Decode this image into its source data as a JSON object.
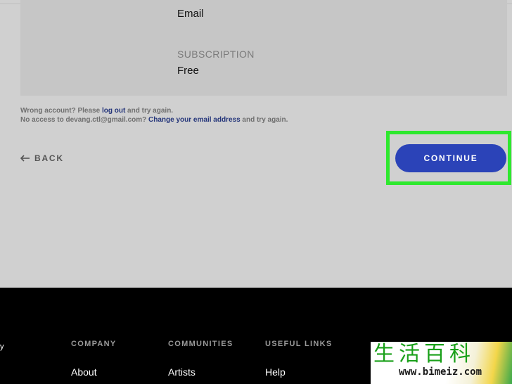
{
  "account_card": {
    "email_value": "Email",
    "plan_label": "SUBSCRIPTION",
    "plan_value": "Free"
  },
  "help": {
    "line1_prefix": "Wrong account? Please ",
    "line1_link": "log out",
    "line1_suffix": " and try again.",
    "line2_prefix": "No access to devang.ctl@gmail.com? ",
    "line2_link": "Change your email address",
    "line2_suffix": " and try again."
  },
  "actions": {
    "back_label": "BACK",
    "back_icon": "arrow-left-icon",
    "continue_label": "CONTINUE"
  },
  "footer": {
    "edge_glyph": "y",
    "columns": [
      {
        "heading": "COMPANY",
        "link": "About"
      },
      {
        "heading": "COMMUNITIES",
        "link": "Artists"
      },
      {
        "heading": "USEFUL LINKS",
        "link": "Help"
      }
    ]
  },
  "watermark": {
    "chars": "生活百科",
    "url": "www.bimeiz.com"
  },
  "colors": {
    "page_bg": "#d0d0d0",
    "card_bg": "#c6c6c6",
    "button_bg": "#2b43b8",
    "highlight": "#2ee82e",
    "link": "#24357a",
    "footer_bg": "#000000"
  }
}
